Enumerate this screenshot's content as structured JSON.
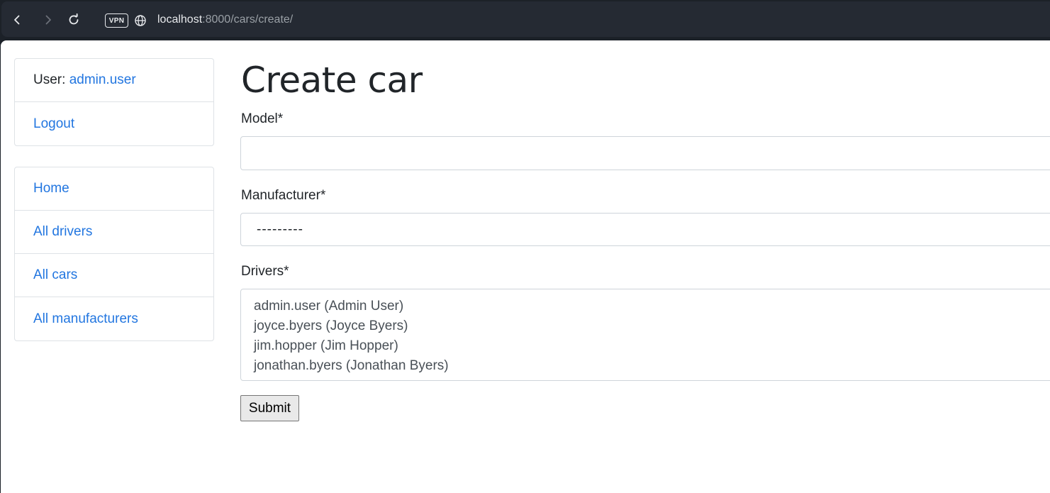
{
  "browser": {
    "vpn_label": "VPN",
    "url_host": "localhost",
    "url_path": ":8000/cars/create/"
  },
  "sidebar": {
    "user_label": "User: ",
    "username": "admin.user",
    "logout": "Logout",
    "nav": [
      {
        "label": "Home"
      },
      {
        "label": "All drivers"
      },
      {
        "label": "All cars"
      },
      {
        "label": "All manufacturers"
      }
    ]
  },
  "form": {
    "title": "Create car",
    "model_label": "Model*",
    "model_value": "",
    "manufacturer_label": "Manufacturer*",
    "manufacturer_selected": "---------",
    "drivers_label": "Drivers*",
    "drivers_options": [
      "admin.user (Admin User)",
      "joyce.byers (Joyce Byers)",
      "jim.hopper (Jim Hopper)",
      "jonathan.byers (Jonathan Byers)"
    ],
    "submit_label": "Submit"
  },
  "colors": {
    "link": "#2276e0",
    "browser_bg": "#1c2128"
  }
}
